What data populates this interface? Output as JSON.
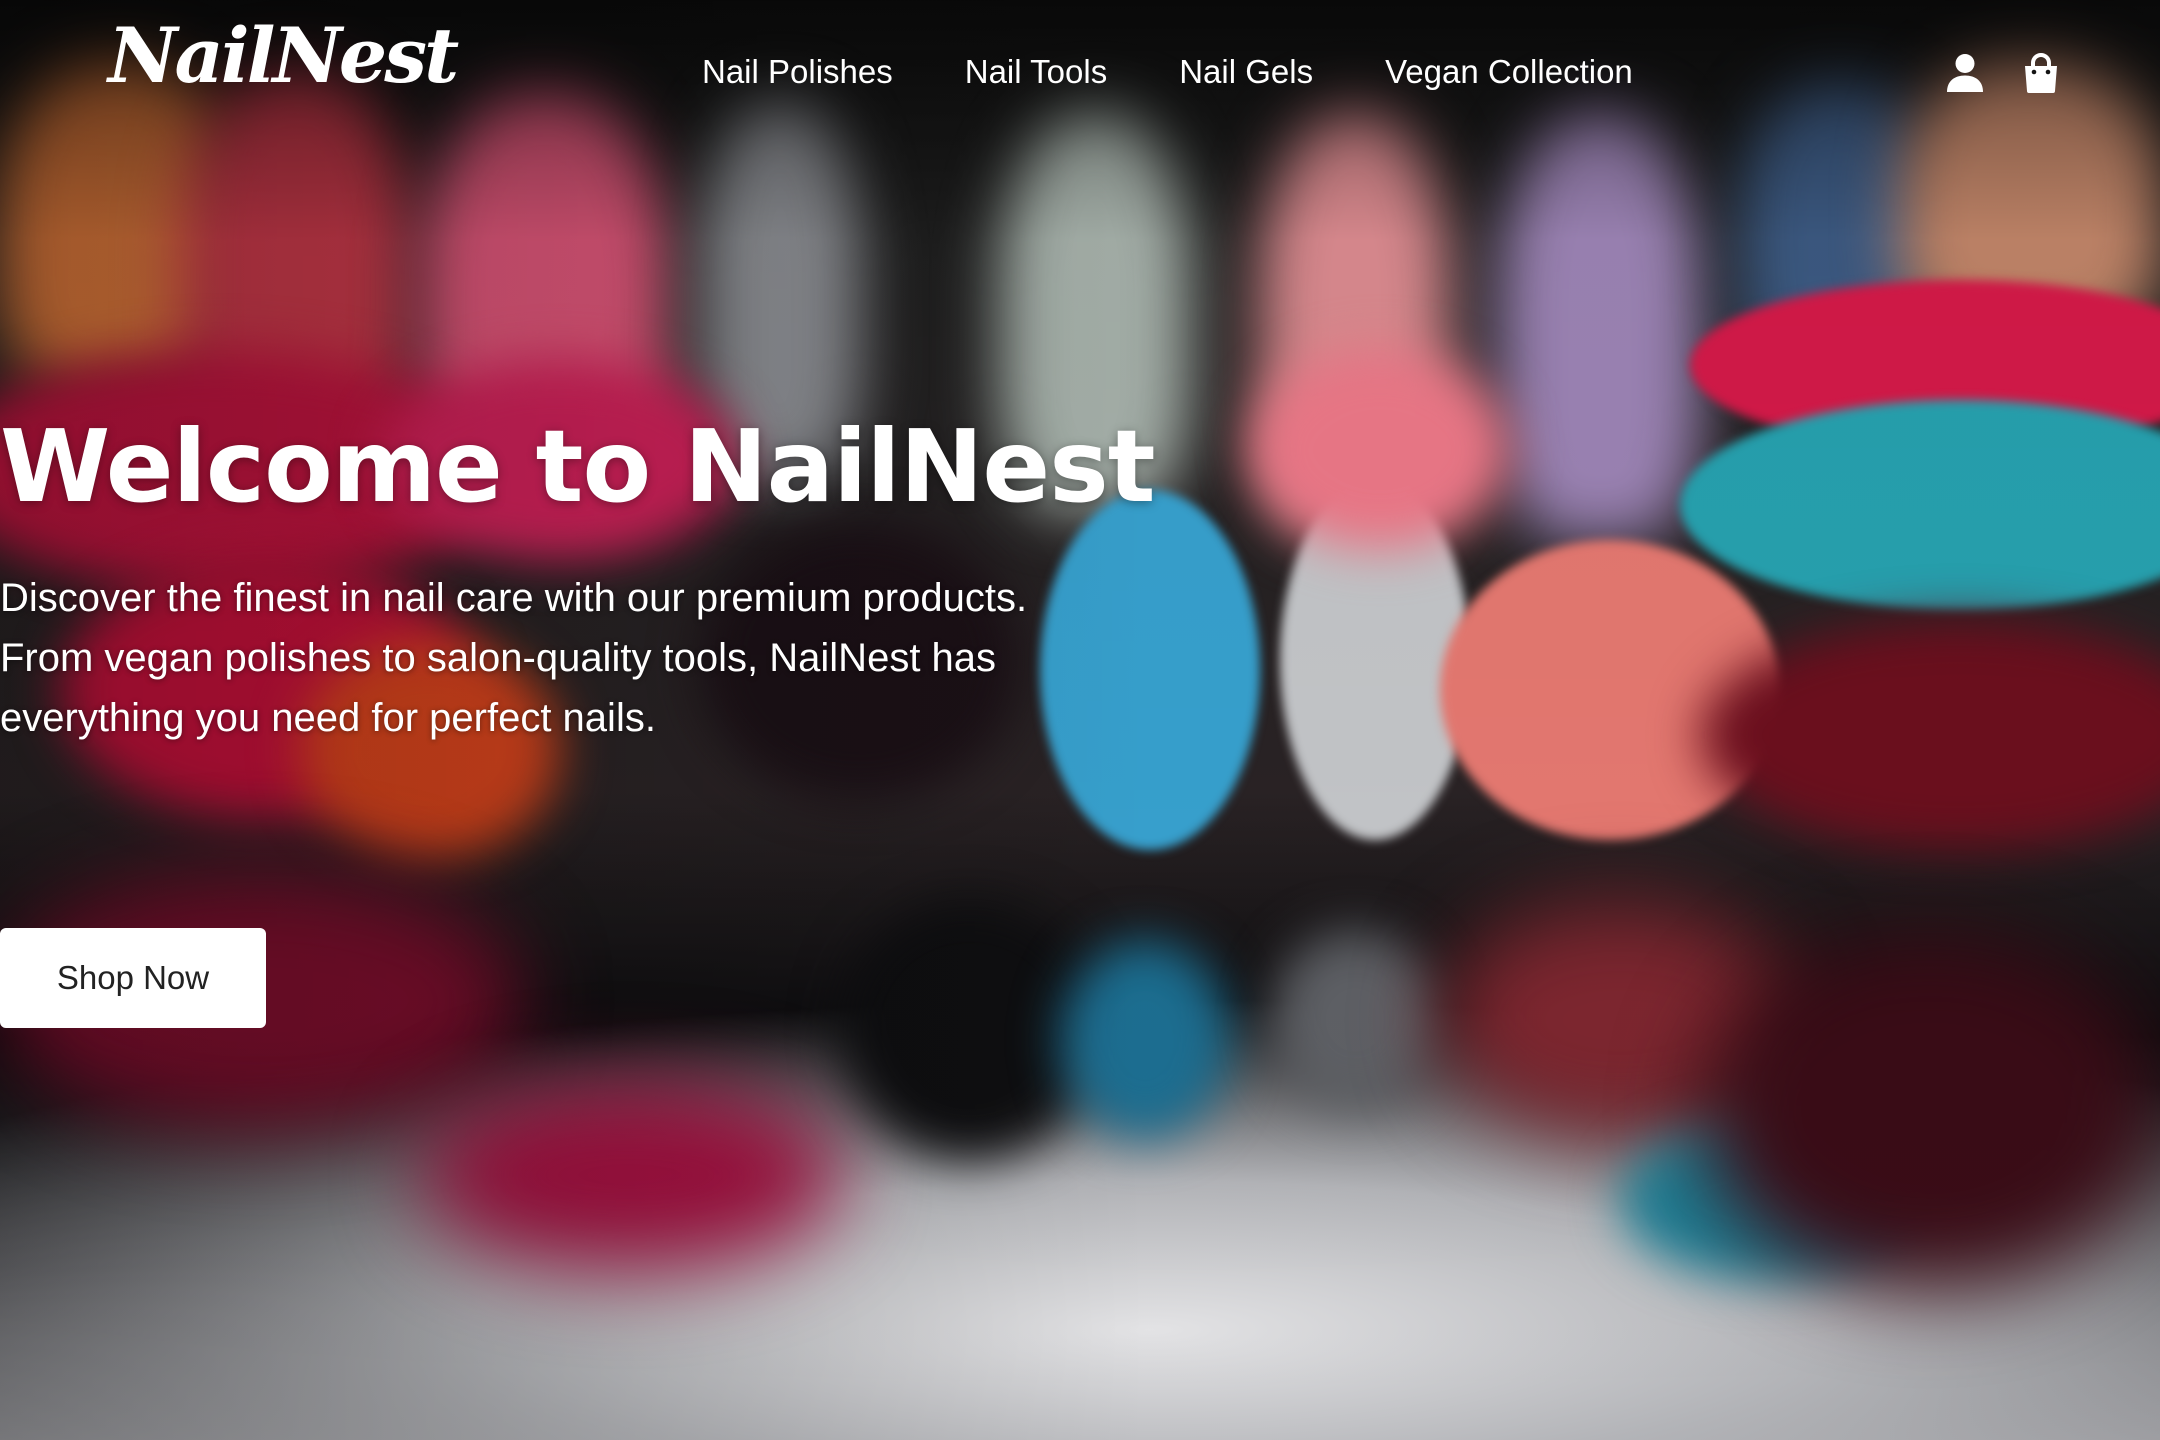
{
  "brand": {
    "logo": "NailNest"
  },
  "nav": {
    "items": [
      {
        "label": "Nail Polishes"
      },
      {
        "label": "Nail Tools"
      },
      {
        "label": "Nail Gels"
      },
      {
        "label": "Vegan Collection"
      }
    ]
  },
  "header_icons": {
    "account": "user-icon",
    "cart": "shopping-bag-icon"
  },
  "hero": {
    "title": "Welcome to NailNest",
    "description": "Discover the finest in nail care with our premium products. From vegan polishes to salon-quality tools, NailNest has everything you need for perfect nails.",
    "cta_label": "Shop Now",
    "background_image": "blurred close-up of rows of colorful nail polish bottles and painted nail tips reflected on a glossy surface"
  },
  "colors": {
    "text": "#ffffff",
    "button_bg": "#ffffff",
    "button_text": "#222222",
    "nail_magenta": "#c8124a",
    "nail_teal": "#1f9aa8",
    "nail_coral": "#e8706a",
    "nail_blue": "#3ea6d4",
    "nail_silver": "#bfc3c7"
  }
}
